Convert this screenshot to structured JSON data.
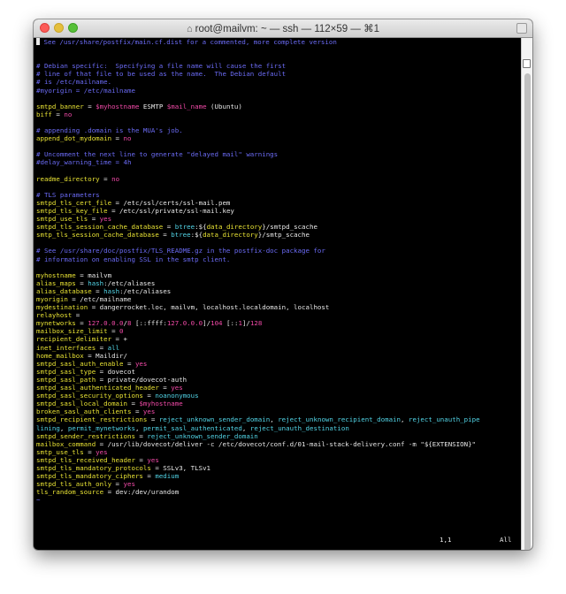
{
  "window": {
    "title": "root@mailvm: ~ — ssh — 112×59 — ⌘1",
    "home_icon": "home-icon"
  },
  "editor": {
    "lines": [
      [
        [
          "c",
          "See /usr/share/postfix/main.cf.dist for a commented, more complete version"
        ]
      ],
      [],
      [],
      [
        [
          "c",
          "# Debian specific:  Specifying a file name will cause the first"
        ]
      ],
      [
        [
          "c",
          "# line of that file to be used as the name.  The Debian default"
        ]
      ],
      [
        [
          "c",
          "# is /etc/mailname."
        ]
      ],
      [
        [
          "c",
          "#myorigin = /etc/mailname"
        ]
      ],
      [],
      [
        [
          "y",
          "smtpd_banner"
        ],
        [
          "w",
          " = "
        ],
        [
          "r",
          "$myhostname"
        ],
        [
          "w",
          " ESMTP "
        ],
        [
          "r",
          "$mail_name"
        ],
        [
          "w",
          " (Ubuntu)"
        ]
      ],
      [
        [
          "y",
          "biff"
        ],
        [
          "w",
          " = "
        ],
        [
          "r",
          "no"
        ]
      ],
      [],
      [
        [
          "c",
          "# appending .domain is the MUA's job."
        ]
      ],
      [
        [
          "y",
          "append_dot_mydomain"
        ],
        [
          "w",
          " = "
        ],
        [
          "r",
          "no"
        ]
      ],
      [],
      [
        [
          "c",
          "# Uncomment the next line to generate \"delayed mail\" warnings"
        ]
      ],
      [
        [
          "c",
          "#delay_warning_time = 4h"
        ]
      ],
      [],
      [
        [
          "y",
          "readme_directory"
        ],
        [
          "w",
          " = "
        ],
        [
          "r",
          "no"
        ]
      ],
      [],
      [
        [
          "c",
          "# TLS parameters"
        ]
      ],
      [
        [
          "y",
          "smtpd_tls_cert_file"
        ],
        [
          "w",
          " = /etc/ssl/certs/ssl-mail.pem"
        ]
      ],
      [
        [
          "y",
          "smtpd_tls_key_file"
        ],
        [
          "w",
          " = /etc/ssl/private/ssl-mail.key"
        ]
      ],
      [
        [
          "y",
          "smtpd_use_tls"
        ],
        [
          "w",
          " = "
        ],
        [
          "r",
          "yes"
        ]
      ],
      [
        [
          "y",
          "smtpd_tls_session_cache_database"
        ],
        [
          "w",
          " = "
        ],
        [
          "cy",
          "btree"
        ],
        [
          "w",
          ":${"
        ],
        [
          "y",
          "data_directory"
        ],
        [
          "w",
          "}/smtpd_scache"
        ]
      ],
      [
        [
          "y",
          "smtp_tls_session_cache_database"
        ],
        [
          "w",
          " = "
        ],
        [
          "cy",
          "btree"
        ],
        [
          "w",
          ":${"
        ],
        [
          "y",
          "data_directory"
        ],
        [
          "w",
          "}/smtp_scache"
        ]
      ],
      [],
      [
        [
          "c",
          "# See /usr/share/doc/postfix/TLS_README.gz in the postfix-doc package for"
        ]
      ],
      [
        [
          "c",
          "# information on enabling SSL in the smtp client."
        ]
      ],
      [],
      [
        [
          "y",
          "myhostname"
        ],
        [
          "w",
          " = mailvm"
        ]
      ],
      [
        [
          "y",
          "alias_maps"
        ],
        [
          "w",
          " = "
        ],
        [
          "cy",
          "hash"
        ],
        [
          "w",
          ":/etc/aliases"
        ]
      ],
      [
        [
          "y",
          "alias_database"
        ],
        [
          "w",
          " = "
        ],
        [
          "cy",
          "hash"
        ],
        [
          "w",
          ":/etc/aliases"
        ]
      ],
      [
        [
          "y",
          "myorigin"
        ],
        [
          "w",
          " = /etc/mailname"
        ]
      ],
      [
        [
          "y",
          "mydestination"
        ],
        [
          "w",
          " = dangerrocket.loc, mailvm, localhost.localdomain, localhost"
        ]
      ],
      [
        [
          "y",
          "relayhost"
        ],
        [
          "w",
          " ="
        ]
      ],
      [
        [
          "y",
          "mynetworks"
        ],
        [
          "w",
          " = "
        ],
        [
          "r",
          "127.0.0.0"
        ],
        [
          "w",
          "/"
        ],
        [
          "r",
          "8"
        ],
        [
          "w",
          " [::ffff:"
        ],
        [
          "r",
          "127.0.0.0"
        ],
        [
          "w",
          "]/"
        ],
        [
          "r",
          "104"
        ],
        [
          "w",
          " [::"
        ],
        [
          "r",
          "1"
        ],
        [
          "w",
          "]/"
        ],
        [
          "r",
          "128"
        ]
      ],
      [
        [
          "y",
          "mailbox_size_limit"
        ],
        [
          "w",
          " = "
        ],
        [
          "r",
          "0"
        ]
      ],
      [
        [
          "y",
          "recipient_delimiter"
        ],
        [
          "w",
          " = +"
        ]
      ],
      [
        [
          "y",
          "inet_interfaces"
        ],
        [
          "w",
          " = "
        ],
        [
          "cy",
          "all"
        ]
      ],
      [
        [
          "y",
          "home_mailbox"
        ],
        [
          "w",
          " = Maildir/"
        ]
      ],
      [
        [
          "y",
          "smtpd_sasl_auth_enable"
        ],
        [
          "w",
          " = "
        ],
        [
          "r",
          "yes"
        ]
      ],
      [
        [
          "y",
          "smtpd_sasl_type"
        ],
        [
          "w",
          " = dovecot"
        ]
      ],
      [
        [
          "y",
          "smtpd_sasl_path"
        ],
        [
          "w",
          " = private/dovecot-auth"
        ]
      ],
      [
        [
          "y",
          "smtpd_sasl_authenticated_header"
        ],
        [
          "w",
          " = "
        ],
        [
          "r",
          "yes"
        ]
      ],
      [
        [
          "y",
          "smtpd_sasl_security_options"
        ],
        [
          "w",
          " = "
        ],
        [
          "cy",
          "noanonymous"
        ]
      ],
      [
        [
          "y",
          "smtpd_sasl_local_domain"
        ],
        [
          "w",
          " = "
        ],
        [
          "r",
          "$myhostname"
        ]
      ],
      [
        [
          "y",
          "broken_sasl_auth_clients"
        ],
        [
          "w",
          " = "
        ],
        [
          "r",
          "yes"
        ]
      ],
      [
        [
          "y",
          "smtpd_recipient_restrictions"
        ],
        [
          "w",
          " = "
        ],
        [
          "cy",
          "reject_unknown_sender_domain"
        ],
        [
          "w",
          ", "
        ],
        [
          "cy",
          "reject_unknown_recipient_domain"
        ],
        [
          "w",
          ", "
        ],
        [
          "cy",
          "reject_unauth_pipe"
        ]
      ],
      [
        [
          "cy",
          "lining"
        ],
        [
          "w",
          ", "
        ],
        [
          "cy",
          "permit_mynetworks"
        ],
        [
          "w",
          ", "
        ],
        [
          "cy",
          "permit_sasl_authenticated"
        ],
        [
          "w",
          ", "
        ],
        [
          "cy",
          "reject_unauth_destination"
        ]
      ],
      [
        [
          "y",
          "smtpd_sender_restrictions"
        ],
        [
          "w",
          " = "
        ],
        [
          "cy",
          "reject_unknown_sender_domain"
        ]
      ],
      [
        [
          "y",
          "mailbox_command"
        ],
        [
          "w",
          " = /usr/lib/dovecot/deliver -c /etc/dovecot/conf.d/01-mail-stack-delivery.conf -m \"${EXTENSION}\""
        ]
      ],
      [
        [
          "y",
          "smtp_use_tls"
        ],
        [
          "w",
          " = "
        ],
        [
          "r",
          "yes"
        ]
      ],
      [
        [
          "y",
          "smtpd_tls_received_header"
        ],
        [
          "w",
          " = "
        ],
        [
          "r",
          "yes"
        ]
      ],
      [
        [
          "y",
          "smtpd_tls_mandatory_protocols"
        ],
        [
          "w",
          " = SSLv3, TLSv1"
        ]
      ],
      [
        [
          "y",
          "smtpd_tls_mandatory_ciphers"
        ],
        [
          "w",
          " = "
        ],
        [
          "cy",
          "medium"
        ]
      ],
      [
        [
          "y",
          "smtpd_tls_auth_only"
        ],
        [
          "w",
          " = "
        ],
        [
          "r",
          "yes"
        ]
      ],
      [
        [
          "y",
          "tls_random_source"
        ],
        [
          "w",
          " = dev:/dev/urandom"
        ]
      ],
      [
        [
          "c",
          "~"
        ]
      ]
    ],
    "status_position": "1,1",
    "status_scroll": "All"
  },
  "colors": {
    "comment": "#6b6bf5",
    "key": "#e8e234",
    "value_pink": "#f24aa8",
    "value_cyan": "#52d4e6",
    "text": "#e8e8e8",
    "background": "#000000"
  }
}
